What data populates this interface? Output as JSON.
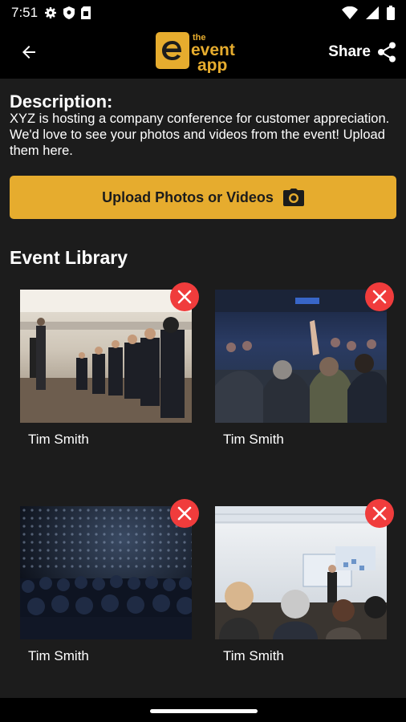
{
  "status_bar": {
    "time": "7:51"
  },
  "app_bar": {
    "logo_text_top": "the",
    "logo_text_main": "event",
    "logo_text_bottom": "app",
    "share_label": "Share"
  },
  "description": {
    "title": "Description:",
    "text": "XYZ is hosting a company conference for customer appreciation. We'd love to see your photos and videos from the event! Upload them here."
  },
  "upload_button": {
    "label": "Upload Photos or Videos"
  },
  "library": {
    "title": "Event Library",
    "items": [
      {
        "author": "Tim Smith"
      },
      {
        "author": "Tim Smith"
      },
      {
        "author": "Tim Smith"
      },
      {
        "author": "Tim Smith"
      }
    ]
  },
  "colors": {
    "accent": "#e6ac2e",
    "delete": "#f03c3c",
    "background": "#1c1c1c",
    "bar": "#000000"
  }
}
